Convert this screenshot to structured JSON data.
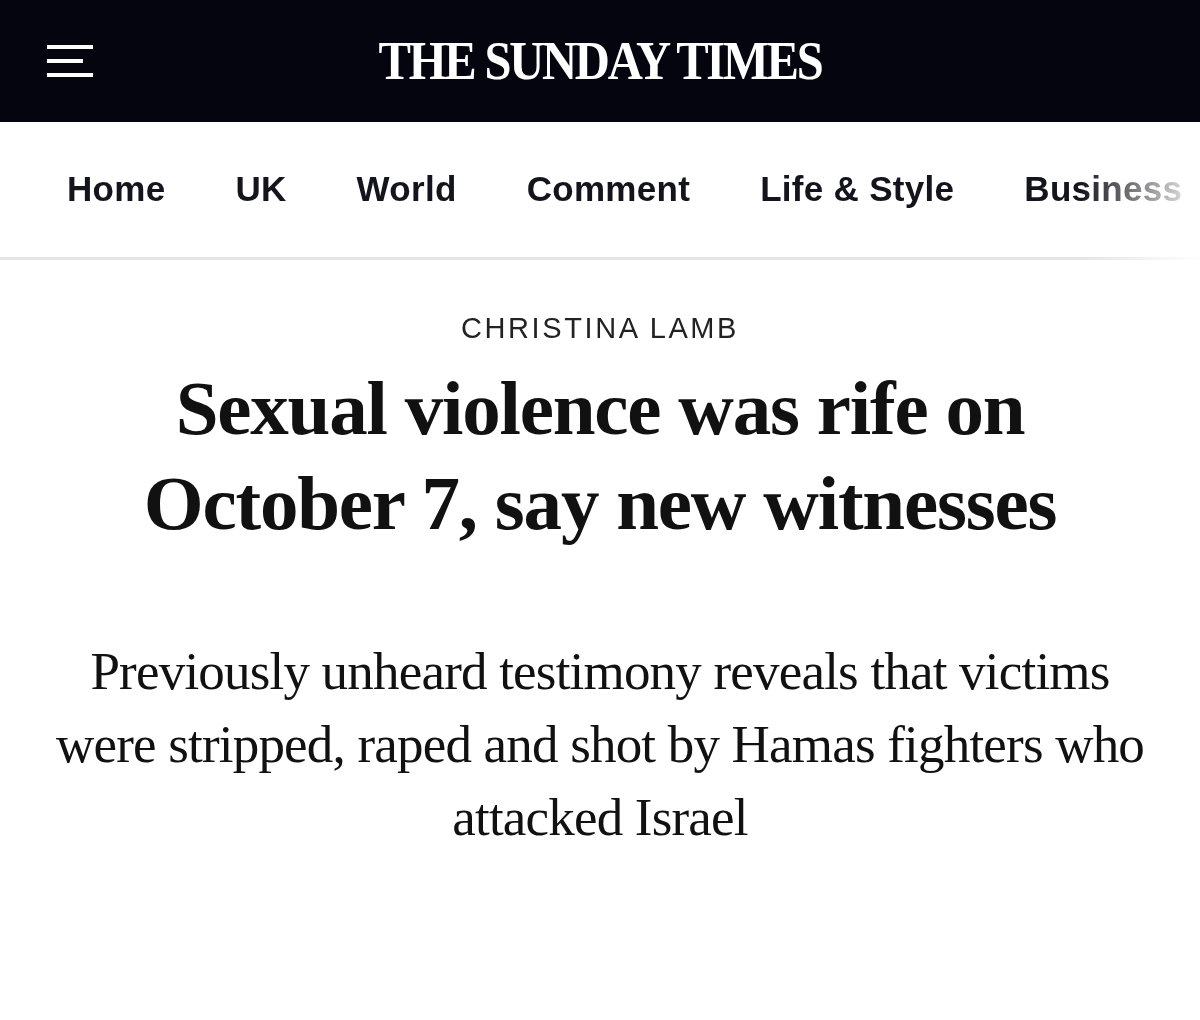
{
  "header": {
    "logo": "THE SUNDAY TIMES"
  },
  "nav": {
    "items": [
      "Home",
      "UK",
      "World",
      "Comment",
      "Life & Style",
      "Business"
    ]
  },
  "article": {
    "byline": "CHRISTINA LAMB",
    "headline": "Sexual violence was rife on October 7, say new witnesses",
    "standfirst": "Previously unheard testimony reveals that victims were stripped, raped and shot by Hamas fighters who attacked Israel"
  }
}
